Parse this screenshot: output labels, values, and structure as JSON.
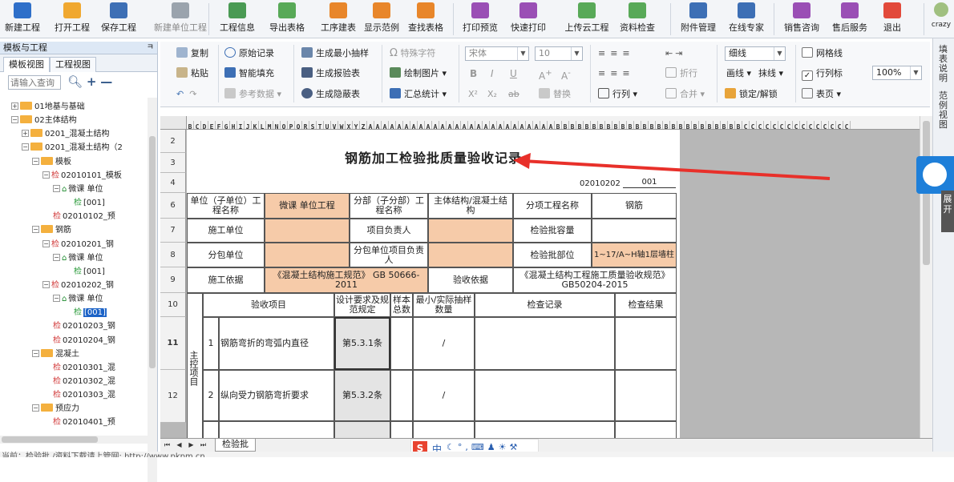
{
  "toolbar": {
    "buttons": [
      {
        "label": "新建工程",
        "icon": "new-project-icon",
        "color": "#2e6fc9"
      },
      {
        "label": "打开工程",
        "icon": "open-folder-icon",
        "color": "#f0a830"
      },
      {
        "label": "保存工程",
        "icon": "save-icon",
        "color": "#3d6fb5"
      },
      {
        "label": "新建单位工程",
        "icon": "home-icon",
        "color": "#9aa3ad"
      },
      {
        "label": "工程信息",
        "icon": "info-icon",
        "color": "#4a9a54"
      },
      {
        "label": "导出表格",
        "icon": "export-table-icon",
        "color": "#58a958"
      },
      {
        "label": "工序建表",
        "icon": "layers-icon",
        "color": "#e8862a"
      },
      {
        "label": "显示范例",
        "icon": "example-icon",
        "color": "#e8862a"
      },
      {
        "label": "查找表格",
        "icon": "find-table-icon",
        "color": "#e8862a"
      },
      {
        "label": "打印预览",
        "icon": "eye-icon",
        "color": "#9a4fb5"
      },
      {
        "label": "快速打印",
        "icon": "printer-icon",
        "color": "#9a4fb5"
      },
      {
        "label": "上传云工程",
        "icon": "cloud-upload-icon",
        "color": "#58a958"
      },
      {
        "label": "资料检查",
        "icon": "checklist-icon",
        "color": "#58a958"
      },
      {
        "label": "附件管理",
        "icon": "paperclip-icon",
        "color": "#3d6fb5"
      },
      {
        "label": "在线专家",
        "icon": "graduation-cap-icon",
        "color": "#3d6fb5"
      },
      {
        "label": "销售咨询",
        "icon": "headset-icon",
        "color": "#9a4fb5"
      },
      {
        "label": "售后服务",
        "icon": "person-icon",
        "color": "#9a4fb5"
      },
      {
        "label": "退出",
        "icon": "power-icon",
        "color": "#e24a3b"
      }
    ],
    "user": "crazy"
  },
  "left_panel": {
    "title": "模板与工程",
    "pin": "ㅋ",
    "tabs": [
      "模板视图",
      "工程视图"
    ],
    "search_placeholder": "请输入查询",
    "tree": [
      {
        "label": "01地基与基础",
        "kind": "folder",
        "exp": "+"
      },
      {
        "label": "02主体结构",
        "kind": "folder",
        "exp": "−"
      },
      {
        "label": "0201_混凝土结构",
        "kind": "folder",
        "exp": "+"
      },
      {
        "label": "0201_混凝土结构（2",
        "kind": "folder",
        "exp": "−"
      },
      {
        "label": "模板",
        "kind": "folder",
        "exp": "−"
      },
      {
        "label": "02010101_模板",
        "kind": "check",
        "exp": "−"
      },
      {
        "label": "微课 单位",
        "kind": "home",
        "exp": "−"
      },
      {
        "label": "[001]",
        "kind": "checkg"
      },
      {
        "label": "02010102_预",
        "kind": "check"
      },
      {
        "label": "钢筋",
        "kind": "folder",
        "exp": "−"
      },
      {
        "label": "02010201_钢",
        "kind": "check",
        "exp": "−"
      },
      {
        "label": "微课 单位",
        "kind": "home",
        "exp": "−"
      },
      {
        "label": "[001]",
        "kind": "checkg"
      },
      {
        "label": "02010202_钢",
        "kind": "check",
        "exp": "−"
      },
      {
        "label": "微课 单位",
        "kind": "home",
        "exp": "−"
      },
      {
        "label": "[001]",
        "kind": "checkg",
        "selected": true
      },
      {
        "label": "02010203_钢",
        "kind": "check"
      },
      {
        "label": "02010204_钢",
        "kind": "check"
      },
      {
        "label": "混凝土",
        "kind": "folder",
        "exp": "−"
      },
      {
        "label": "02010301_混",
        "kind": "check"
      },
      {
        "label": "02010302_混",
        "kind": "check"
      },
      {
        "label": "02010303_混",
        "kind": "check"
      },
      {
        "label": "预应力",
        "kind": "folder",
        "exp": "−"
      },
      {
        "label": "02010401_预",
        "kind": "check"
      }
    ]
  },
  "ribbon": {
    "copy": "复制",
    "paste": "粘贴",
    "original_record": "原始记录",
    "smart_fill": "智能填充",
    "ref_data": "参考数据",
    "gen_min_sample": "生成最小抽样",
    "gen_report": "生成报验表",
    "gen_hidden": "生成隐蔽表",
    "special_char": "特殊字符",
    "draw_image": "绘制图片",
    "summary": "汇总统计",
    "font_name": "宋体",
    "font_size": "10",
    "bold": "B",
    "italic": "I",
    "underline": "U",
    "grow": "A",
    "shrink": "A",
    "sup": "X²",
    "sub": "X₂",
    "strike": "ab",
    "replace": "替换",
    "row_col": "行列",
    "fold": "折行",
    "merge": "合并",
    "lock": "锁定/解锁",
    "line_style": "细线",
    "draw_line": "画线",
    "erase_line": "抹线",
    "gridlines": "网格线",
    "row_col_marks": "行列标",
    "sheet_page": "表页",
    "zoom": "100%",
    "gridlines_checked": false,
    "row_col_marks_checked": true
  },
  "sheet": {
    "col_letters": [
      "B",
      "C",
      "D",
      "E",
      "F",
      "G",
      "H",
      "I",
      "J",
      "K",
      "L",
      "M",
      "N",
      "O",
      "P",
      "Q",
      "R",
      "S",
      "T",
      "U",
      "V",
      "W",
      "X",
      "Y",
      "Z",
      "AA",
      "AB",
      "AC",
      "AD",
      "AE",
      "AF",
      "AG",
      "AH",
      "AI",
      "AJ",
      "AK",
      "AL",
      "AM",
      "AN",
      "AO",
      "AP",
      "AQ",
      "AR",
      "AS",
      "AT",
      "AU",
      "AV",
      "AW",
      "AX",
      "AY",
      "AZ",
      "BA",
      "BB",
      "BC",
      "BD",
      "BE",
      "BF",
      "BG",
      "BH",
      "BI",
      "BJ",
      "BK",
      "BL",
      "BM",
      "BN",
      "BO",
      "BP",
      "BQ",
      "BR",
      "BS",
      "BT",
      "BU",
      "BV",
      "BW",
      "BX",
      "BY",
      "BZ",
      "CA",
      "CB",
      "CC",
      "CD",
      "CE",
      "CF",
      "CG",
      "CH",
      "CI",
      "CJ",
      "CK",
      "CL",
      "CM",
      "CN",
      "CO"
    ],
    "row_numbers": [
      "2",
      "3",
      "4",
      "6",
      "7",
      "8",
      "9",
      "10",
      "11",
      "12"
    ],
    "title": "钢筋加工检验批质量验收记录",
    "code": "02010202",
    "serial": "001",
    "unit_project_label": "单位（子单位）工程名称",
    "unit_project_value": "微课 单位工程",
    "division_label": "分部（子分部）工程名称",
    "division_value": "主体结构/混凝土结构",
    "subitem_label": "分项工程名称",
    "subitem_value": "钢筋",
    "contractor_label": "施工单位",
    "project_lead_label": "项目负责人",
    "batch_capacity_label": "检验批容量",
    "sub_contractor_label": "分包单位",
    "sub_lead_label": "分包单位项目负责人",
    "batch_location_label": "检验批部位",
    "batch_location_value": "1~17/A~H轴1层墙柱",
    "basis_label": "施工依据",
    "basis_value": "《混凝土结构施工规范》 GB 50666-2011",
    "acceptance_basis_label": "验收依据",
    "acceptance_basis_value": "《混凝土结构工程施工质量验收规范》GB50204-2015",
    "col_item": "验收项目",
    "col_design": "设计要求及规范规定",
    "col_sample_total": "样本总数",
    "col_min_actual": "最小/实际抽样数量",
    "col_record": "检查记录",
    "col_result": "检查结果",
    "main_control": "主控项目",
    "items": [
      {
        "no": "1",
        "name": "钢筋弯折的弯弧内直径",
        "clause": "第5.3.1条",
        "min": "/"
      },
      {
        "no": "2",
        "name": "纵向受力钢筋弯折要求",
        "clause": "第5.3.2条",
        "min": "/"
      }
    ],
    "tab": "检验批"
  },
  "right_side": {
    "tab1": "填表说明",
    "tab2": "范例视图",
    "expand": "展开"
  },
  "ime": {
    "logo": "S",
    "mode": "中"
  },
  "status": "当前：检验批  /资料下载请上管网: http://www.pkpm.cn"
}
